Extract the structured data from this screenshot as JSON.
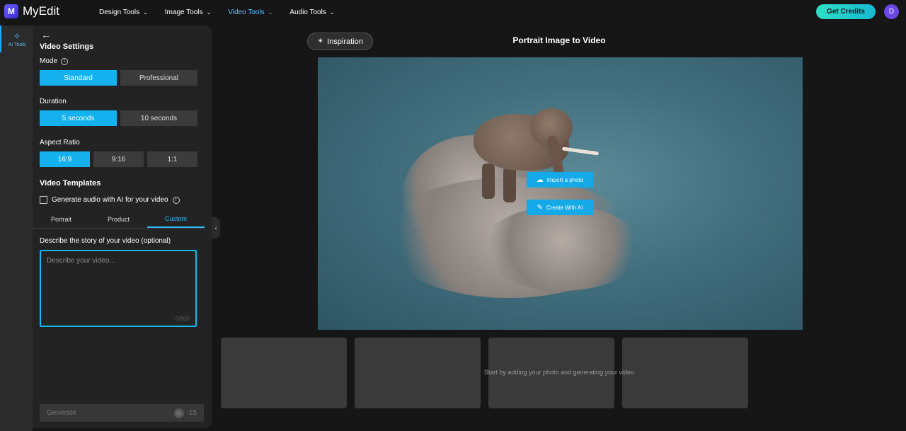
{
  "app": {
    "name": "MyEdit",
    "logo_glyph": "M"
  },
  "nav": {
    "items": [
      {
        "label": "Design Tools",
        "active": false
      },
      {
        "label": "Image Tools",
        "active": false
      },
      {
        "label": "Video Tools",
        "active": true
      },
      {
        "label": "Audio Tools",
        "active": false
      }
    ],
    "get_credits": "Get Credits",
    "avatar_initial": "D"
  },
  "rail": {
    "ai_tools_label": "AI Tools",
    "ai_tools_icon": "magic-wand-icon"
  },
  "panel": {
    "title": "Video Settings",
    "mode": {
      "label": "Mode",
      "options": [
        "Standard",
        "Professional"
      ],
      "selected": "Standard"
    },
    "duration": {
      "label": "Duration",
      "options": [
        "5 seconds",
        "10 seconds"
      ],
      "selected": "5 seconds"
    },
    "aspect_ratio": {
      "label": "Aspect Ratio",
      "options": [
        "16:9",
        "9:16",
        "1:1"
      ],
      "selected": "16:9"
    },
    "templates": {
      "title": "Video Templates",
      "generate_audio_label": "Generate audio with AI for your video",
      "generate_audio_checked": false,
      "tabs": [
        "Portrait",
        "Product",
        "Custom"
      ],
      "active_tab": "Custom"
    },
    "story": {
      "label": "Describe the story of your video (optional)",
      "placeholder": "Describe your video...",
      "counter": "0/800"
    },
    "generate": {
      "label": "Generate",
      "cost": "-15"
    }
  },
  "main": {
    "inspiration_label": "Inspiration",
    "title": "Portrait Image to Video",
    "import_photo": "Import a photo",
    "create_with_ai": "Create With AI",
    "thumbnails_message": "Start by adding your photo and generating your video"
  },
  "colors": {
    "accent": "#15b0ee",
    "background": "#161616",
    "panel": "#232323"
  }
}
